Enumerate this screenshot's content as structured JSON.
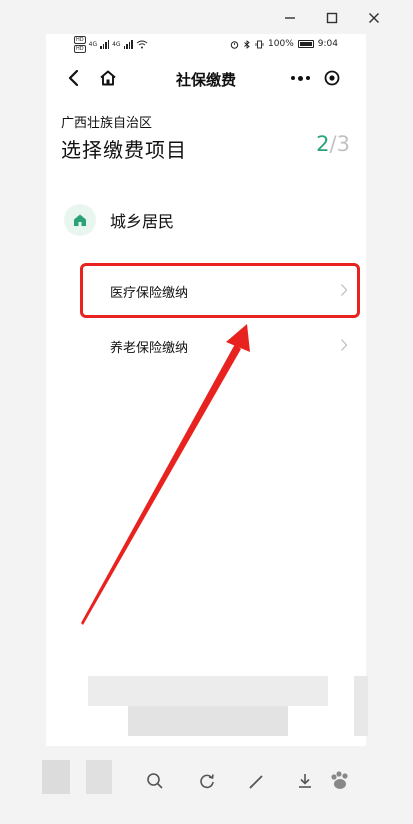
{
  "status_bar": {
    "left_badges": [
      "HD",
      "HD"
    ],
    "network_labels": [
      "4G",
      "4G"
    ],
    "battery": "100%",
    "time": "9:04"
  },
  "nav": {
    "title": "社保缴费"
  },
  "page": {
    "region": "广西壮族自治区",
    "heading": "选择缴费项目",
    "step_current": "2",
    "step_separator": "/",
    "step_total": "3"
  },
  "category": {
    "label": "城乡居民",
    "icon": "home-icon"
  },
  "items": [
    {
      "label": "医疗保险缴纳"
    },
    {
      "label": "养老保险缴纳"
    }
  ],
  "colors": {
    "accent": "#2ba37a",
    "highlight": "#e8231f"
  }
}
